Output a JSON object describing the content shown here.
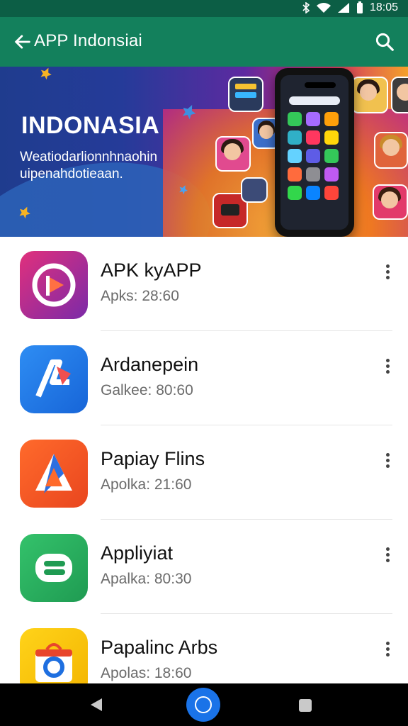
{
  "statusbar": {
    "time": "18:05"
  },
  "appbar": {
    "title": "APP Indonsiai"
  },
  "banner": {
    "title": "INDONASIA",
    "subtitle": "Weatiodarlionnhnaohin uipenahdotieaan."
  },
  "apps": [
    {
      "name": "APK kyAPP",
      "sub": "Apks: 28:60"
    },
    {
      "name": "Ardanepein",
      "sub": "Galkee: 80:60"
    },
    {
      "name": "Papiay Flins",
      "sub": "Apolka: 21:60"
    },
    {
      "name": "Appliyiat",
      "sub": "Apalka: 80:30"
    },
    {
      "name": "Papalinc Arbs",
      "sub": "Apolas: 18:60"
    }
  ],
  "icons": {
    "back": "back-arrow-icon",
    "search": "search-icon",
    "more": "more-vert-icon"
  },
  "colors": {
    "statusbar": "#0c5e45",
    "appbar": "#13805c"
  }
}
